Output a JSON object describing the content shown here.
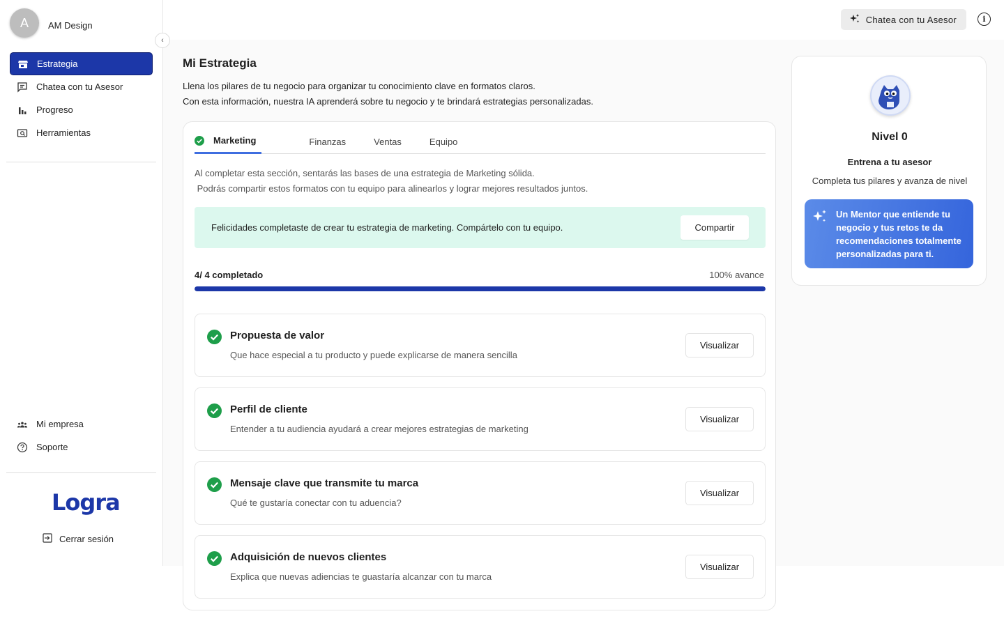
{
  "sidebar": {
    "avatar_initial": "A",
    "profile_name": "AM Design",
    "collapse_icon": "chevron-left-icon",
    "nav": [
      {
        "label": "Estrategia",
        "icon": "store-icon",
        "active": true
      },
      {
        "label": "Chatea con tu Asesor",
        "icon": "chat-icon",
        "active": false
      },
      {
        "label": "Progreso",
        "icon": "bar-chart-icon",
        "active": false
      },
      {
        "label": "Herramientas",
        "icon": "tools-icon",
        "active": false
      }
    ],
    "bottom_nav": [
      {
        "label": "Mi empresa",
        "icon": "people-icon"
      },
      {
        "label": "Soporte",
        "icon": "help-icon"
      }
    ],
    "logo": "Logra",
    "logout_label": "Cerrar sesión"
  },
  "topbar": {
    "chat_button": "Chatea con tu Asesor",
    "info_icon": "info-icon"
  },
  "main": {
    "title": "Mi Estrategia",
    "desc_line1": "Llena los pilares de tu negocio para organizar tu conocimiento clave en formatos claros.",
    "desc_line2": "Con esta información, nuestra IA aprenderá sobre tu negocio y te brindará estrategias personalizadas.",
    "tabs": [
      {
        "label": "Marketing",
        "active": true
      },
      {
        "label": "Finanzas"
      },
      {
        "label": "Ventas"
      },
      {
        "label": "Equipo"
      }
    ],
    "section_line1": "Al completar esta sección, sentarás las bases de una estrategia de Marketing sólida.",
    "section_line2": " Podrás compartir estos formatos con tu equipo para alinearlos y lograr mejores resultados juntos.",
    "banner_text": "Felicidades completaste de crear tu estrategia de marketing. Compártelo con tu equipo.",
    "share_button": "Compartir",
    "progress_label": "4/ 4 completado",
    "progress_pct_label": "100% avance",
    "progress_value": 1.0,
    "items": [
      {
        "title": "Propuesta de valor",
        "desc": "Que hace especial a tu producto y puede explicarse de manera sencilla",
        "button": "Visualizar"
      },
      {
        "title": "Perfil de cliente",
        "desc": "Entender a tu audiencia ayudará a crear mejores estrategias de marketing",
        "button": "Visualizar"
      },
      {
        "title": "Mensaje clave que transmite tu marca",
        "desc": "Qué te gustaría conectar con tu aduencia?",
        "button": "Visualizar"
      },
      {
        "title": "Adquisición de nuevos clientes",
        "desc": "Explica que nuevas adiencias te guastaría alcanzar con tu marca",
        "button": "Visualizar"
      }
    ]
  },
  "level_panel": {
    "title": "Nivel 0",
    "subtitle": "Entrena a tu asesor",
    "desc": "Completa tus pilares y avanza de nivel",
    "mentor_text": "Un Mentor que entiende tu negocio y tus retos te da recomendaciones totalmente personalizadas para ti."
  },
  "colors": {
    "brand": "#1c37a8",
    "tab_underline": "#3f6ee0",
    "success": "#1e9e4a",
    "banner_bg": "#dcf8ee"
  }
}
